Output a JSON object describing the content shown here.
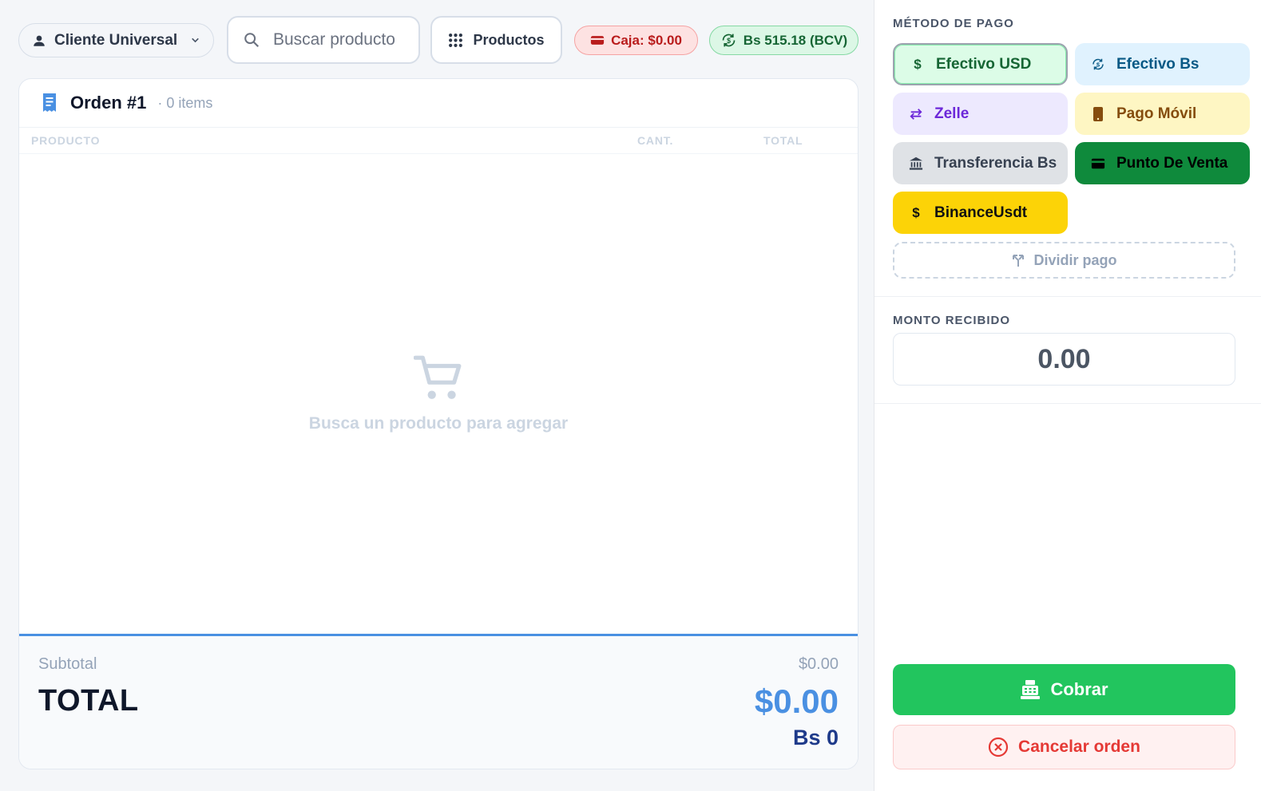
{
  "header": {
    "client": "Cliente Universal",
    "search_placeholder": "Buscar producto",
    "products_label": "Productos",
    "caja": "Caja: $0.00",
    "rate": "Bs 515.18 (BCV)"
  },
  "order": {
    "title": "Orden #1",
    "count": "· 0 items",
    "columns": [
      "PRODUCTO",
      "CANT.",
      "TOTAL"
    ],
    "empty_text": "Busca un producto para agregar",
    "subtotal_label": "Subtotal",
    "subtotal_value": "$0.00",
    "total_label": "TOTAL",
    "total_value": "$0.00",
    "total_bs": "Bs 0"
  },
  "payment": {
    "section_label": "MÉTODO DE PAGO",
    "methods": [
      {
        "label": "Efectivo USD",
        "icon": "dollar-icon",
        "bg": "#dcfce7",
        "fg": "#166534",
        "selected": true
      },
      {
        "label": "Efectivo Bs",
        "icon": "currency-exchange-icon",
        "bg": "#e0f2fe",
        "fg": "#075985",
        "selected": false
      },
      {
        "label": "Zelle",
        "icon": "swap-arrows-icon",
        "bg": "#ede9fe",
        "fg": "#6d28d9",
        "selected": false
      },
      {
        "label": "Pago Móvil",
        "icon": "phone-icon",
        "bg": "#fef6c3",
        "fg": "#854d0e",
        "selected": false
      },
      {
        "label": "Transferencia Bs",
        "icon": "bank-icon",
        "bg": "#dfe2e6",
        "fg": "#374151",
        "selected": false
      },
      {
        "label": "Punto De Venta",
        "icon": "card-icon",
        "bg": "#0f8a3c",
        "fg": "#000000",
        "selected": false
      },
      {
        "label": "BinanceUsdt",
        "icon": "dollar-icon",
        "bg": "#fcd307",
        "fg": "#111111",
        "selected": false
      }
    ],
    "split_label": "Dividir pago",
    "amount_label": "MONTO RECIBIDO",
    "amount_value": "0.00",
    "charge_label": "Cobrar",
    "cancel_label": "Cancelar orden"
  }
}
